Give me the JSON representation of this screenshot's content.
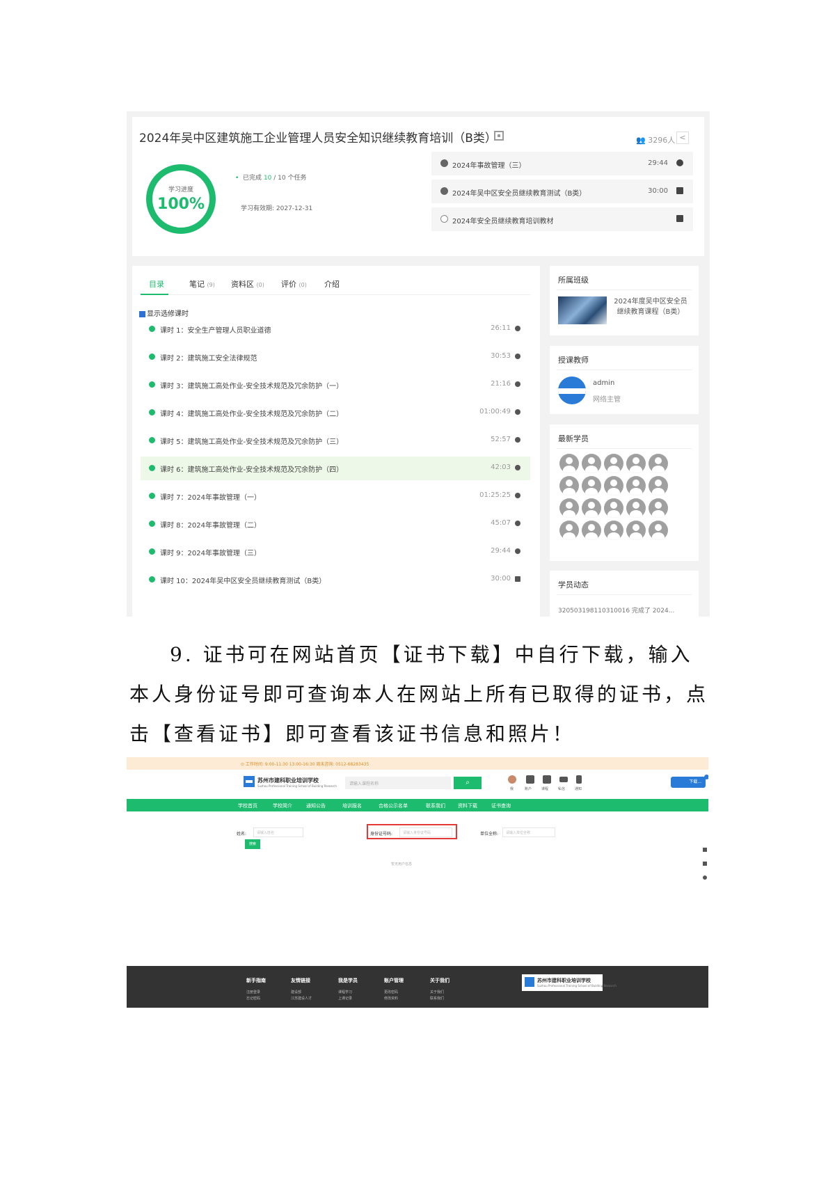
{
  "shot1": {
    "course_title": "2024年吴中区建筑施工企业管理人员安全知识继续教育培训（B类）",
    "student_count": "3296人",
    "share_icon": "share-icon",
    "progress": {
      "label": "学习进度",
      "percent_text": "100%",
      "percent": 100,
      "completed_prefix": "已完成",
      "completed_num": "10",
      "completed_suffix": "/ 10 个任务",
      "valid_until": "学习有效期:  2027-12-31"
    },
    "recent_tasks": [
      {
        "title": "2024年事故管理（三）",
        "time": "29:44",
        "status": "done"
      },
      {
        "title": "2024年吴中区安全员继续教育测试（B类）",
        "time": "30:00",
        "status": "done"
      },
      {
        "title": "2024年安全员继续教育培训教材",
        "time": "",
        "status": "open"
      }
    ],
    "tabs": [
      {
        "label": "目录",
        "count": ""
      },
      {
        "label": "笔记",
        "count": "(9)"
      },
      {
        "label": "资料区",
        "count": "(0)"
      },
      {
        "label": "评价",
        "count": "(0)"
      },
      {
        "label": "介绍",
        "count": ""
      }
    ],
    "show_optional": "显示选修课时",
    "lessons": [
      {
        "title": "课时 1：安全生产管理人员职业道德",
        "time": "26:11"
      },
      {
        "title": "课时 2：建筑施工安全法律规范",
        "time": "30:53"
      },
      {
        "title": "课时 3：建筑施工高处作业-安全技术规范及冗余防护（一）",
        "time": "21:16"
      },
      {
        "title": "课时 4：建筑施工高处作业-安全技术规范及冗余防护（二）",
        "time": "01:00:49"
      },
      {
        "title": "课时 5：建筑施工高处作业-安全技术规范及冗余防护（三）",
        "time": "52:57"
      },
      {
        "title": "课时 6：建筑施工高处作业-安全技术规范及冗余防护（四）",
        "time": "42:03"
      },
      {
        "title": "课时 7：2024年事故管理（一）",
        "time": "01:25:25"
      },
      {
        "title": "课时 8：2024年事故管理（二）",
        "time": "45:07"
      },
      {
        "title": "课时 9：2024年事故管理（三）",
        "time": "29:44"
      },
      {
        "title": "课时 10：2024年吴中区安全员继续教育测试（B类）",
        "time": "30:00"
      }
    ],
    "class_section": {
      "title": "所属班级",
      "name": "2024年度吴中区安全员继续教育课程（B类）"
    },
    "teacher_section": {
      "title": "授课教师",
      "name": "admin",
      "role": "网络主管"
    },
    "students_title": "最新学员",
    "activity": {
      "title": "学员动态",
      "text": "320503198110310016 完成了 2024..."
    }
  },
  "paragraph": {
    "line1": "9. 证书可在网站首页【证书下载】中自行下载，输入",
    "line2": "本人身份证号即可查询本人在网站上所有已取得的证书，点",
    "line3": "击【查看证书】即可查看该证书信息和照片！"
  },
  "shot2": {
    "top_notice": "⊙ 工作时间: 9:00-11:30 13:00-16:30 周末咨询: 0512-68283435",
    "school_name": "苏州市建科职业培训学校",
    "school_sub": "Suzhou Professional Training School of Building Research",
    "search_placeholder": "请输入课程名称",
    "user_menu": [
      "我",
      "账户",
      "课程",
      "私信",
      "通知"
    ],
    "download_label": "下载...",
    "nav": [
      "学校首页",
      "学校简介",
      "通知公告",
      "培训报名",
      "合格公示名单",
      "联系我们",
      "资料下载",
      "证书查询"
    ],
    "form": {
      "name_label": "姓名:",
      "name_placeholder": "请输入姓名",
      "id_label": "身份证号码:",
      "id_placeholder": "请输入身份证号码",
      "unit_label": "单位全称:",
      "unit_placeholder": "请输入单位全称",
      "query_btn": "搜索"
    },
    "no_result": "暂无用户信息",
    "footer": [
      {
        "title": "新手指南",
        "items": [
          "注册登录",
          "忘记密码"
        ]
      },
      {
        "title": "友情链接",
        "items": [
          "建设部",
          "江苏建设人才"
        ]
      },
      {
        "title": "我是学员",
        "items": [
          "课程学习",
          "上课记录"
        ]
      },
      {
        "title": "账户管理",
        "items": [
          "更改密码",
          "修改资料"
        ]
      },
      {
        "title": "关于我们",
        "items": [
          "关于我们",
          "联系我们"
        ]
      }
    ],
    "footer_logo": "苏州市建科职业培训学校",
    "footer_logo_sub": "Suzhou Professional Training School of Building Research"
  }
}
